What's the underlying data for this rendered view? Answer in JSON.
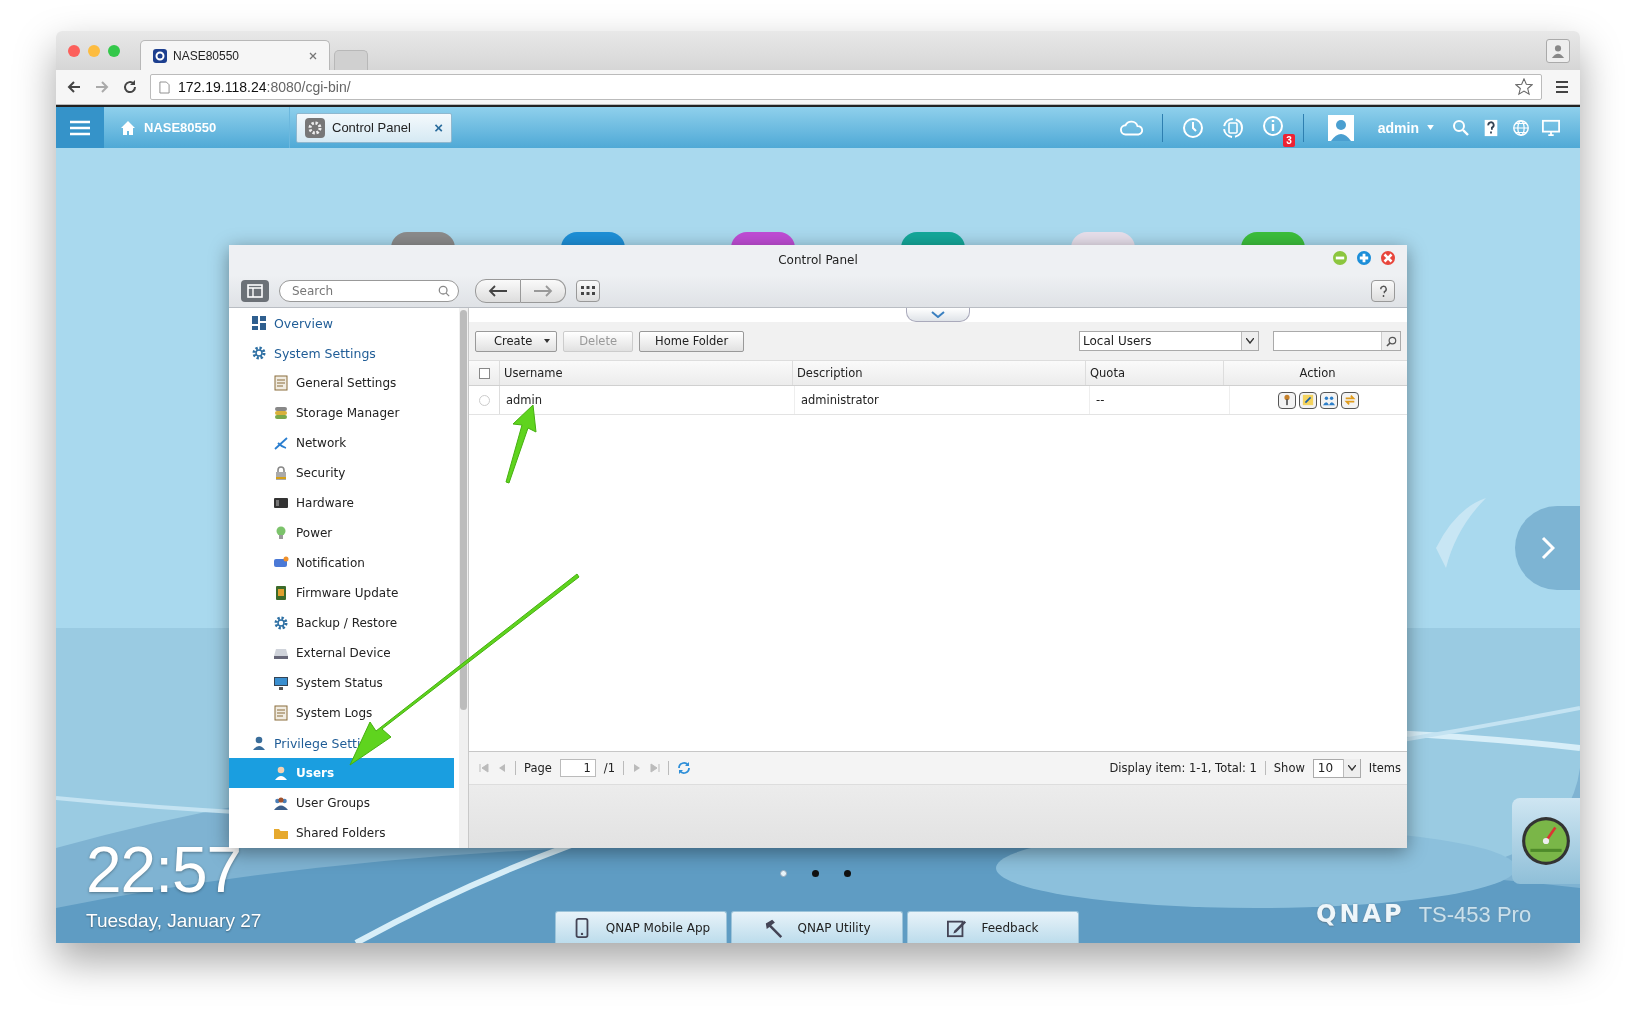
{
  "browser": {
    "tabs": [
      {
        "title": "NASE80550",
        "selected": true
      },
      {
        "selected": false
      }
    ],
    "url_host": "172.19.118.24",
    "url_rest": ":8080/cgi-bin/"
  },
  "taskbar": {
    "home": "NASE80550",
    "open_app": "Control Panel",
    "close_glyph": "×",
    "notification_count": "3",
    "user": "admin"
  },
  "window": {
    "title": "Control Panel",
    "search_placeholder": "Search",
    "sidebar": [
      {
        "label": "Overview",
        "kind": "section",
        "selected": false
      },
      {
        "label": "System Settings",
        "kind": "section",
        "selected": false
      },
      {
        "label": "General Settings",
        "kind": "item",
        "selected": false
      },
      {
        "label": "Storage Manager",
        "kind": "item",
        "selected": false
      },
      {
        "label": "Network",
        "kind": "item",
        "selected": false
      },
      {
        "label": "Security",
        "kind": "item",
        "selected": false
      },
      {
        "label": "Hardware",
        "kind": "item",
        "selected": false
      },
      {
        "label": "Power",
        "kind": "item",
        "selected": false
      },
      {
        "label": "Notification",
        "kind": "item",
        "selected": false
      },
      {
        "label": "Firmware Update",
        "kind": "item",
        "selected": false
      },
      {
        "label": "Backup / Restore",
        "kind": "item",
        "selected": false
      },
      {
        "label": "External Device",
        "kind": "item",
        "selected": false
      },
      {
        "label": "System Status",
        "kind": "item",
        "selected": false
      },
      {
        "label": "System Logs",
        "kind": "item",
        "selected": false
      },
      {
        "label": "Privilege Setti",
        "kind": "section",
        "selected": false
      },
      {
        "label": "Users",
        "kind": "item",
        "selected": true
      },
      {
        "label": "User Groups",
        "kind": "item",
        "selected": false
      },
      {
        "label": "Shared Folders",
        "kind": "item",
        "selected": false
      }
    ],
    "toolbar": {
      "create": "Create",
      "delete": "Delete",
      "delete_disabled": true,
      "home_folder": "Home Folder",
      "filter": "Local Users"
    },
    "table": {
      "all_checked": false,
      "columns": [
        "Username",
        "Description",
        "Quota",
        "Action"
      ],
      "rows": [
        {
          "cells": [
            "admin",
            "administrator",
            "--"
          ],
          "checked": false
        }
      ]
    },
    "pager": {
      "page_label": "Page",
      "page": "1",
      "page_total": "/1",
      "display": "Display item: 1-1, Total: 1",
      "show_label": "Show",
      "show": "10",
      "items": "Items"
    }
  },
  "desktop": {
    "time": "22:57",
    "date": "Tuesday, January 27",
    "pages": [
      {
        "selected": true
      },
      {
        "selected": false
      },
      {
        "selected": false
      }
    ],
    "dock": [
      "QNAP Mobile App",
      "QNAP Utility",
      "Feedback"
    ],
    "brand": "QNAP",
    "model": "TS-453 Pro"
  }
}
